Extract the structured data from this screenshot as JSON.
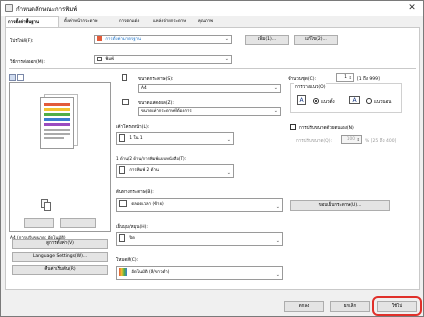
{
  "window": {
    "title": "กำหนดลักษณะการพิมพ์",
    "close_glyph": "✕"
  },
  "tabs": [
    {
      "label": "การตั้งค่าพื้นฐาน",
      "active": true
    },
    {
      "label": "ตั้งค่าหน้ากระดาษ"
    },
    {
      "label": "การตกแต่ง"
    },
    {
      "label": "แหล่งจ่ายกระดาษ"
    },
    {
      "label": "คุณภาพ"
    }
  ],
  "profile": {
    "label": "โปรไฟล์(F):",
    "value": "การตั้งค่ามาตรฐาน",
    "add_button": "เพิ่ม(1)...",
    "edit_button": "แก้ไข(2)..."
  },
  "output": {
    "label": "วิธีการส่งออก(M):",
    "value": "พิมพ์"
  },
  "preview": {
    "caption": "A4 (การปรับขนาด: อัตโนมัติ)"
  },
  "page_size": {
    "label": "ขนาดกระดาษ(S):",
    "value": "A4"
  },
  "output_size": {
    "label": "ขนาดแสดงผล(Z):",
    "value": "ขนาดเท่ากระดาษที่ต้องการ"
  },
  "copies": {
    "label": "จำนวนชุด(C):",
    "value": "1",
    "range": "[1 ถึง 999]"
  },
  "orientation": {
    "label": "การวางแนว(O)",
    "portrait": "แนวตั้ง",
    "landscape": "แนวนอน",
    "portrait_icon": "A",
    "landscape_icon": "A"
  },
  "layout": {
    "label": "เค้าโครงหน้า(L):",
    "value": "1 ใน 1"
  },
  "manual_scaling": {
    "label": "การปรับขนาดด้วยตนเอง(N)",
    "scale_label": "การปรับขนาด(Q):",
    "scale_value": "100",
    "scale_range": "% [25 ถึง 400]"
  },
  "duplex": {
    "label": "1 ด้าน/2 ด้าน/การพิมพ์แบบหนังสือ(T):",
    "value": "การพิมพ์ 2 ด้าน"
  },
  "paper_source": {
    "label": "ต้นทางกระดาษ(B):",
    "value": "ตลอดเวลา (ซ้าย)"
  },
  "binding_button": "ขอบเย็บกระดาษ(U)...",
  "finishing": {
    "label": "เย็บมุม/หมุน(H):",
    "value": "ปิด"
  },
  "color_mode": {
    "label": "โหมดสี(C):",
    "value": "อัตโนมัติ (สี/ขาวดำ)"
  },
  "side_buttons": {
    "view_settings": "ดูการตั้งค่า(V)",
    "language": "Language Settings(W)...",
    "restore": "คืนค่าเริ่มต้น(R)"
  },
  "footer": {
    "ok": "ตกลง",
    "cancel": "ยกเลิก",
    "apply": "ใช้ไป"
  },
  "colors": {
    "highlight": "#e0302a",
    "accent": "#1a6fc4",
    "brand": "#e25b3a"
  }
}
